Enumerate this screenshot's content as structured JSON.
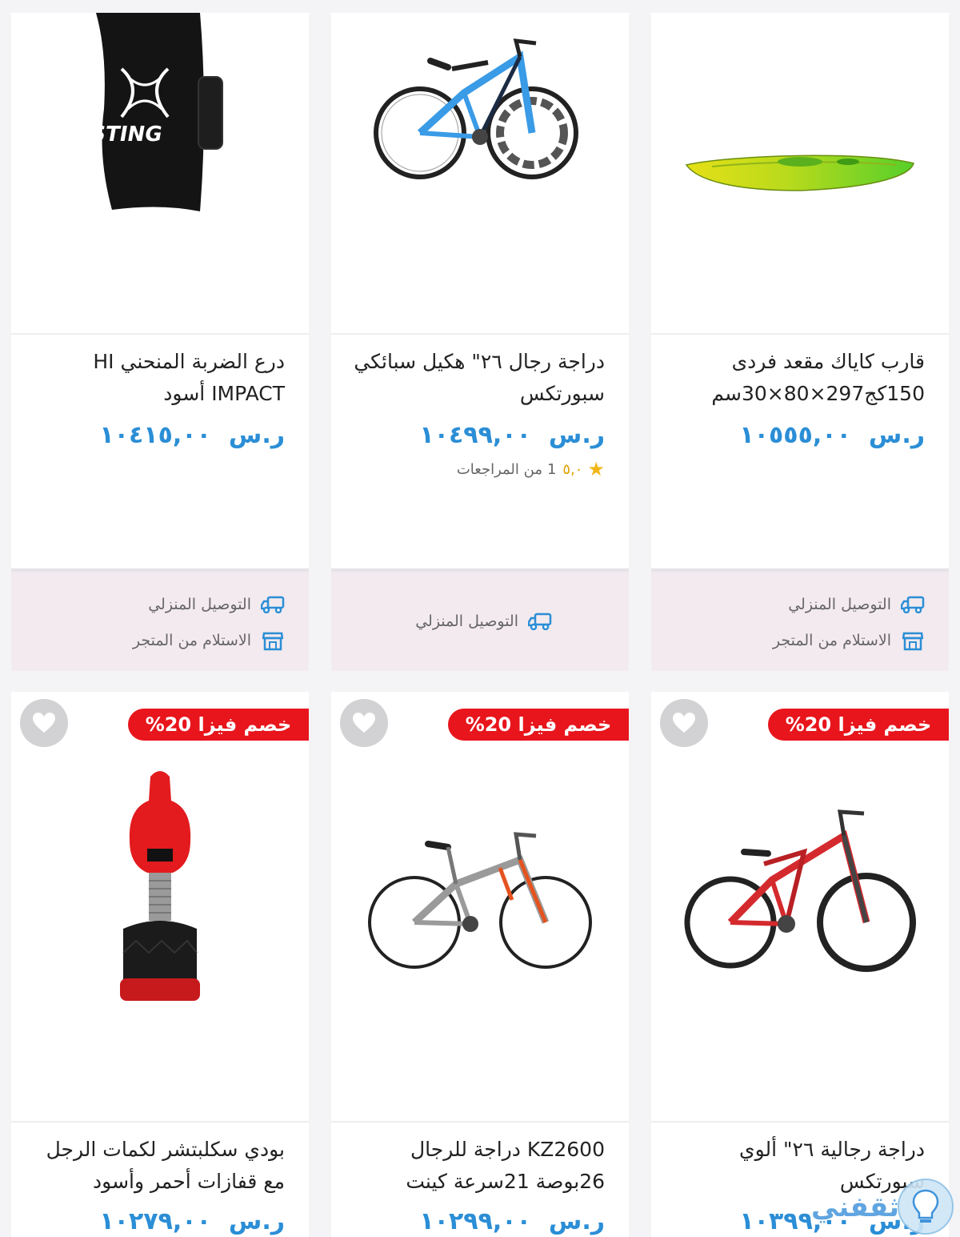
{
  "colors": {
    "accent_price": "#2b8ed6",
    "badge_red": "#e8151c",
    "footer_bg": "#f3eaef",
    "star": "#f2b61a"
  },
  "currency": "ر.س",
  "delivery": {
    "home": "التوصيل المنزلي",
    "store": "الاستلام من المتجر"
  },
  "badge_text": "خصم فيزا 20%",
  "row1": [
    {
      "title": "قارب كاياك مقعد فردى 150كج297×80×30سم",
      "price": "١٠٥٥٥,٠٠",
      "image": "kayak",
      "has_home": true,
      "has_store": true
    },
    {
      "title": "دراجة رجال ٢٦\" هكيل سبائكي سبورتكس",
      "price": "١٠٤٩٩,٠٠",
      "image": "folding-bicycle",
      "rating_score": "٥,٠",
      "rating_count": "1",
      "rating_text": "من المراجعات",
      "has_home": true,
      "has_store": false
    },
    {
      "title": "درع الضربة المنحني HI IMPACT أسود",
      "price": "١٠٤١٥,٠٠",
      "image": "sting-strike-shield",
      "has_home": true,
      "has_store": true
    }
  ],
  "row2": [
    {
      "title": "دراجة رجالية ٢٦\" ألوي سبورتكس",
      "price": "١٠٣٩٩,٠٠",
      "image": "red-bicycle"
    },
    {
      "title": "KZ2600 دراجة للرجال 26بوصة 21سرعة كينت",
      "price": "١٠٢٩٩,٠٠",
      "image": "grey-bicycle"
    },
    {
      "title": "بودي سكلبتشر لكمات الرجل مع قفازات أحمر وأسود",
      "price": "١٠٢٧٩,٠٠",
      "image": "boxing-dummy"
    }
  ],
  "watermark": "ثقفني"
}
